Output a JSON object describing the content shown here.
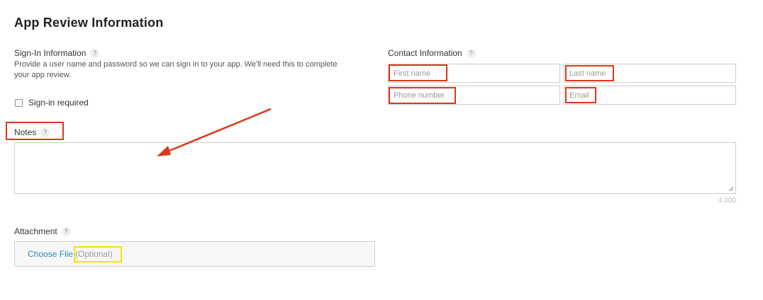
{
  "title": "App Review Information",
  "signin": {
    "label": "Sign-In Information",
    "help": "?",
    "description": "Provide a user name and password so we can sign in to your app. We'll need this to complete your app review.",
    "checkbox_label": "Sign-in required",
    "checked": false
  },
  "contact": {
    "label": "Contact Information",
    "help": "?",
    "first_name_placeholder": "First name",
    "last_name_placeholder": "Last name",
    "phone_placeholder": "Phone number",
    "email_placeholder": "Email"
  },
  "notes": {
    "label": "Notes",
    "help": "?",
    "char_limit": "4,000"
  },
  "attachment": {
    "label": "Attachment",
    "help": "?",
    "choose_file": "Choose File",
    "optional": "(Optional)"
  },
  "colors": {
    "annotation_red": "#d93a1a",
    "annotation_yellow": "#f2e600",
    "link_blue": "#2b86c5"
  }
}
